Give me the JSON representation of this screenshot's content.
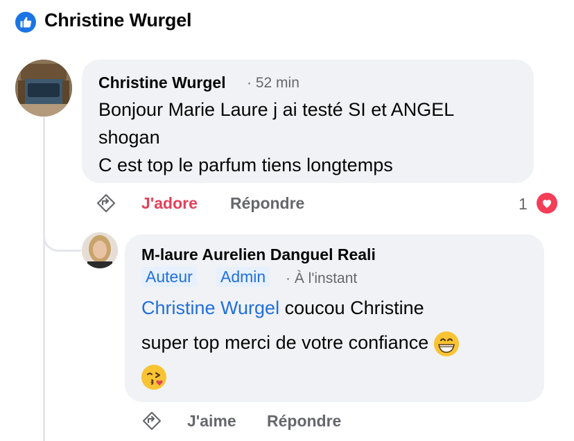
{
  "header": {
    "title": "Christine Wurgel",
    "icon": "like-thumb-icon",
    "accent": "#1b74e4"
  },
  "comments": [
    {
      "author": "Christine Wurgel",
      "time_separator": "·",
      "time": "52 min",
      "lines": [
        "Bonjour Marie Laure j ai testé SI et ANGEL",
        "shogan",
        "C est top le parfum tiens longtemps"
      ],
      "actions": {
        "react_label": "J'adore",
        "reply_label": "Répondre",
        "react_count": "1",
        "react_color": "#e4405a",
        "reaction_icon": "heart-icon"
      }
    },
    {
      "author": "M-laure Aurelien Danguel Reali",
      "badges": [
        "Auteur",
        "Admin"
      ],
      "time_separator": "·",
      "time": "À l'instant",
      "mention": "Christine Wurgel",
      "line1_rest": "coucou Christine",
      "line2": "super top merci de votre confiance",
      "emoji_inline": "grinning-face-emoji",
      "emoji_line": "kissing-face-heart-emoji",
      "actions": {
        "react_label": "J'aime",
        "reply_label": "Répondre"
      }
    }
  ]
}
